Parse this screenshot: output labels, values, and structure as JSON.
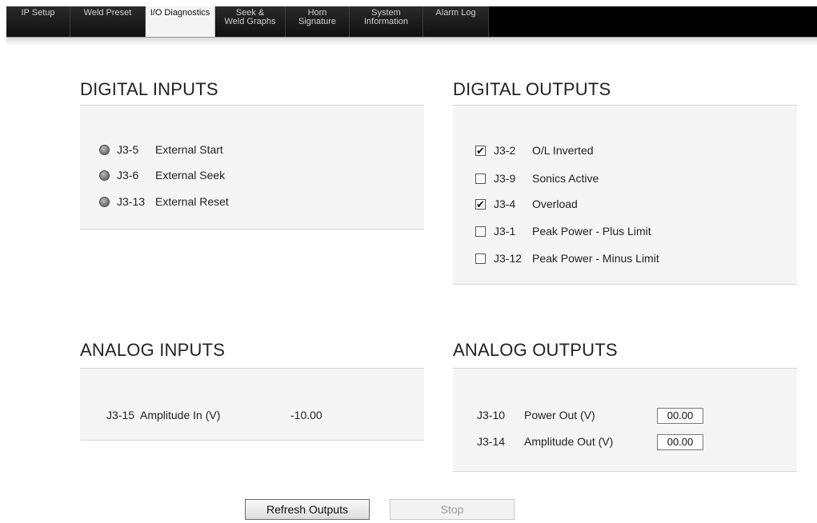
{
  "tabs": [
    {
      "line1": "IP Setup",
      "line2": ""
    },
    {
      "line1": "Weld Preset",
      "line2": ""
    },
    {
      "line1": "I/O Diagnostics",
      "line2": ""
    },
    {
      "line1": "Seek &",
      "line2": "Weld Graphs"
    },
    {
      "line1": "Horn",
      "line2": "Signature"
    },
    {
      "line1": "System",
      "line2": "Information"
    },
    {
      "line1": "Alarm Log",
      "line2": ""
    }
  ],
  "active_tab": "I/O Diagnostics",
  "digital_inputs": {
    "title": "DIGITAL INPUTS",
    "items": [
      {
        "pin": "J3-5",
        "label": "External Start"
      },
      {
        "pin": "J3-6",
        "label": "External Seek"
      },
      {
        "pin": "J3-13",
        "label": "External Reset"
      }
    ]
  },
  "digital_outputs": {
    "title": "DIGITAL OUTPUTS",
    "items": [
      {
        "pin": "J3-2",
        "label": "O/L Inverted",
        "checked": true
      },
      {
        "pin": "J3-9",
        "label": "Sonics Active",
        "checked": false
      },
      {
        "pin": "J3-4",
        "label": "Overload",
        "checked": true
      },
      {
        "pin": "J3-1",
        "label": "Peak Power - Plus Limit",
        "checked": false
      },
      {
        "pin": "J3-12",
        "label": "Peak Power - Minus Limit",
        "checked": false
      }
    ]
  },
  "analog_inputs": {
    "title": "ANALOG INPUTS",
    "items": [
      {
        "pin": "J3-15",
        "label": "Amplitude In (V)",
        "value": "-10.00"
      }
    ]
  },
  "analog_outputs": {
    "title": "ANALOG OUTPUTS",
    "items": [
      {
        "pin": "J3-10",
        "label": "Power Out (V)",
        "value": "00.00"
      },
      {
        "pin": "J3-14",
        "label": "Amplitude Out (V)",
        "value": "00.00"
      }
    ]
  },
  "buttons": {
    "refresh": "Refresh Outputs",
    "stop": "Stop"
  }
}
